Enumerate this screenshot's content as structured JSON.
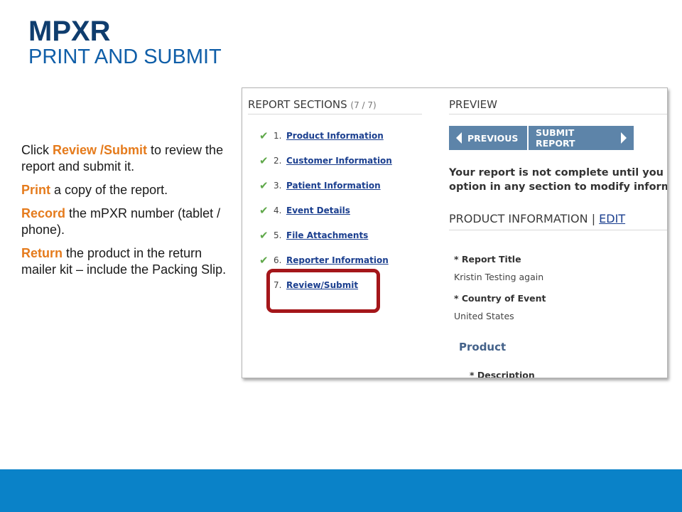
{
  "slide": {
    "title": "MPXR",
    "subtitle": "PRINT AND SUBMIT",
    "instructions": [
      {
        "highlight": "Review /Submit",
        "before": "Click ",
        "after": "  to review the report and submit it."
      },
      {
        "highlight": "Print",
        "before": "",
        "after": "  a copy of the report."
      },
      {
        "highlight": "Record",
        "before": "",
        "after": " the mPXR number (tablet / phone)."
      },
      {
        "highlight": "Return",
        "before": "",
        "after": " the product in the return mailer kit – include the Packing Slip."
      }
    ]
  },
  "screenshot": {
    "report_sections": {
      "heading": "REPORT SECTIONS",
      "count": "(7 / 7)",
      "items": [
        {
          "number": "1.",
          "label": "Product Information",
          "checked": true
        },
        {
          "number": "2.",
          "label": "Customer Information",
          "checked": true
        },
        {
          "number": "3.",
          "label": "Patient Information",
          "checked": true
        },
        {
          "number": "4.",
          "label": "Event Details",
          "checked": true
        },
        {
          "number": "5.",
          "label": "File Attachments",
          "checked": true
        },
        {
          "number": "6.",
          "label": "Reporter Information",
          "checked": true
        },
        {
          "number": "7.",
          "label": "Review/Submit",
          "checked": false
        }
      ]
    },
    "preview": {
      "heading": "PREVIEW",
      "previous_label": "PREVIOUS",
      "submit_label": "SUBMIT REPORT",
      "note_line1": "Your report is not complete until you re",
      "note_line2": "option in any section to modify informa",
      "section_title": "PRODUCT INFORMATION",
      "separator": "|",
      "edit_label": "EDIT",
      "fields": [
        {
          "label": "* Report Title",
          "value": "Kristin Testing again"
        },
        {
          "label": "* Country of Event",
          "value": "United States"
        }
      ],
      "product_heading": "Product",
      "description_label": "* Description"
    },
    "highlight_color": "#a4161a"
  },
  "colors": {
    "title": "#0f3d6e",
    "subtitle": "#0f5ea8",
    "highlight_text": "#e57b1c",
    "button": "#5d84a9",
    "check": "#5fa84a",
    "footer": "#0a82c8"
  }
}
